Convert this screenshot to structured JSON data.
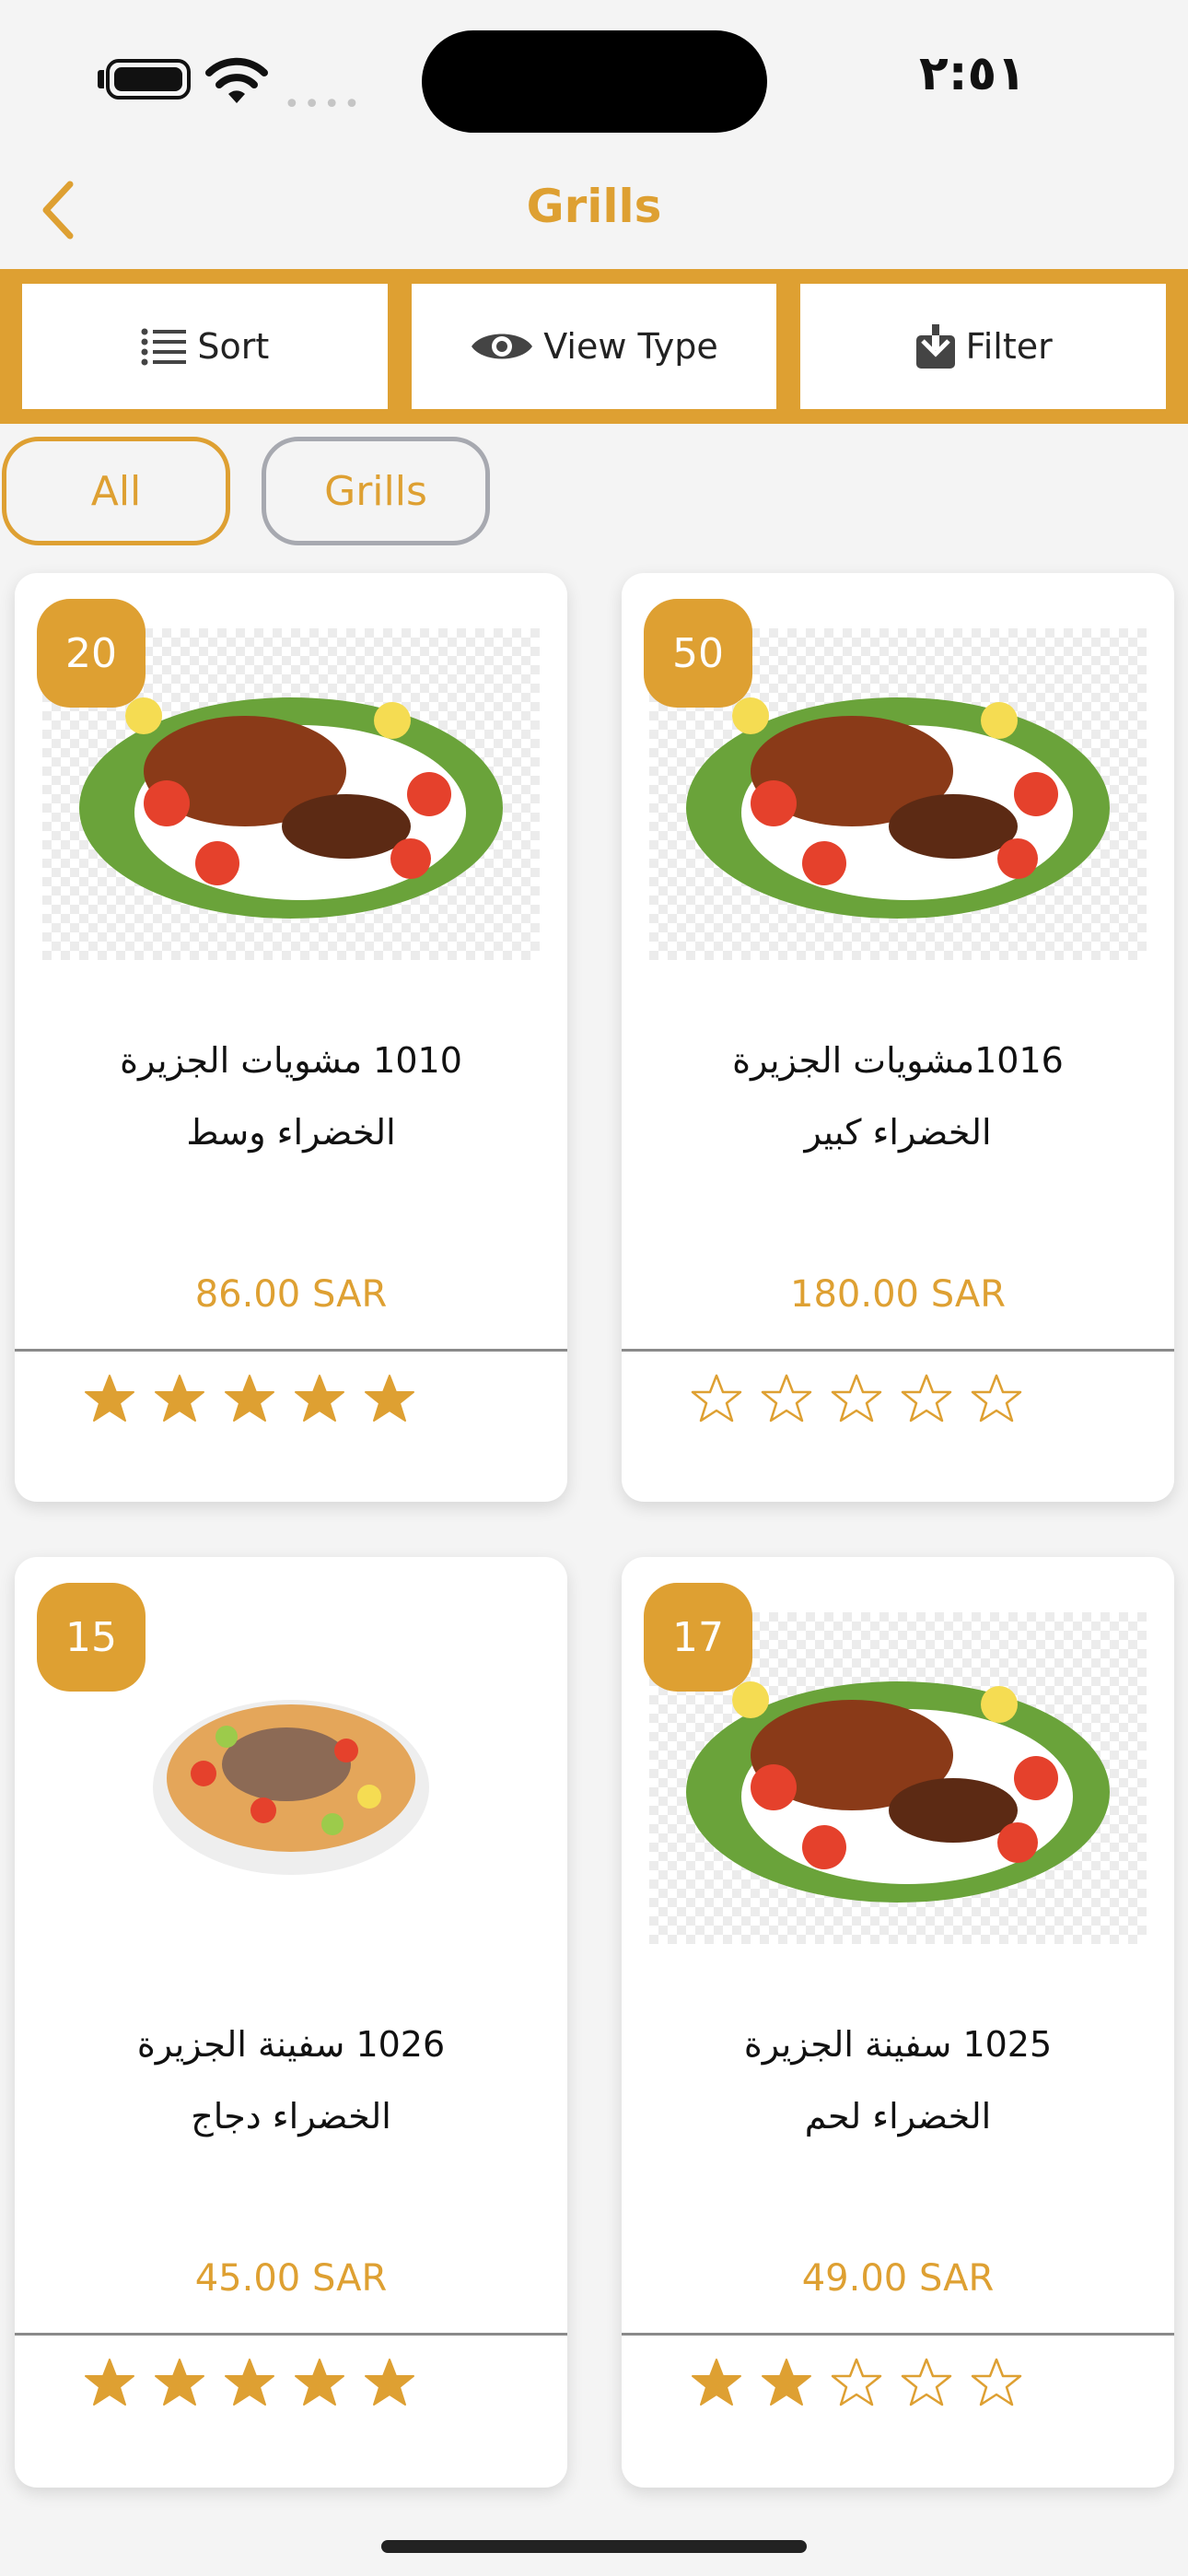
{
  "status": {
    "time": "٢:٥١",
    "signal": "••••"
  },
  "header": {
    "title": "Grills"
  },
  "toolbar": {
    "sort": "Sort",
    "view_type": "View Type",
    "filter": "Filter"
  },
  "chips": {
    "all": "All",
    "grills": "Grills"
  },
  "products": [
    {
      "badge": "20",
      "line1": "1010 مشويات الجزيرة",
      "line2": "الخضراء وسط",
      "price": "86.00  SAR",
      "rating": 5,
      "image": "grill-platter"
    },
    {
      "badge": "50",
      "line1": "1016مشويات الجزيرة",
      "line2": "الخضراء كبير",
      "price": "180.00  SAR",
      "rating": 0,
      "image": "grill-platter"
    },
    {
      "badge": "15",
      "line1": "1026 سفينة الجزيرة",
      "line2": "الخضراء دجاج",
      "price": "45.00  SAR",
      "rating": 5,
      "image": "rice-platter"
    },
    {
      "badge": "17",
      "line1": "1025 سفينة الجزيرة",
      "line2": "الخضراء لحم",
      "price": "49.00  SAR",
      "rating": 2,
      "image": "grill-platter"
    }
  ],
  "colors": {
    "accent": "#dea032",
    "chip_inactive_border": "#a7a9b0",
    "background": "#f4f4f4"
  }
}
